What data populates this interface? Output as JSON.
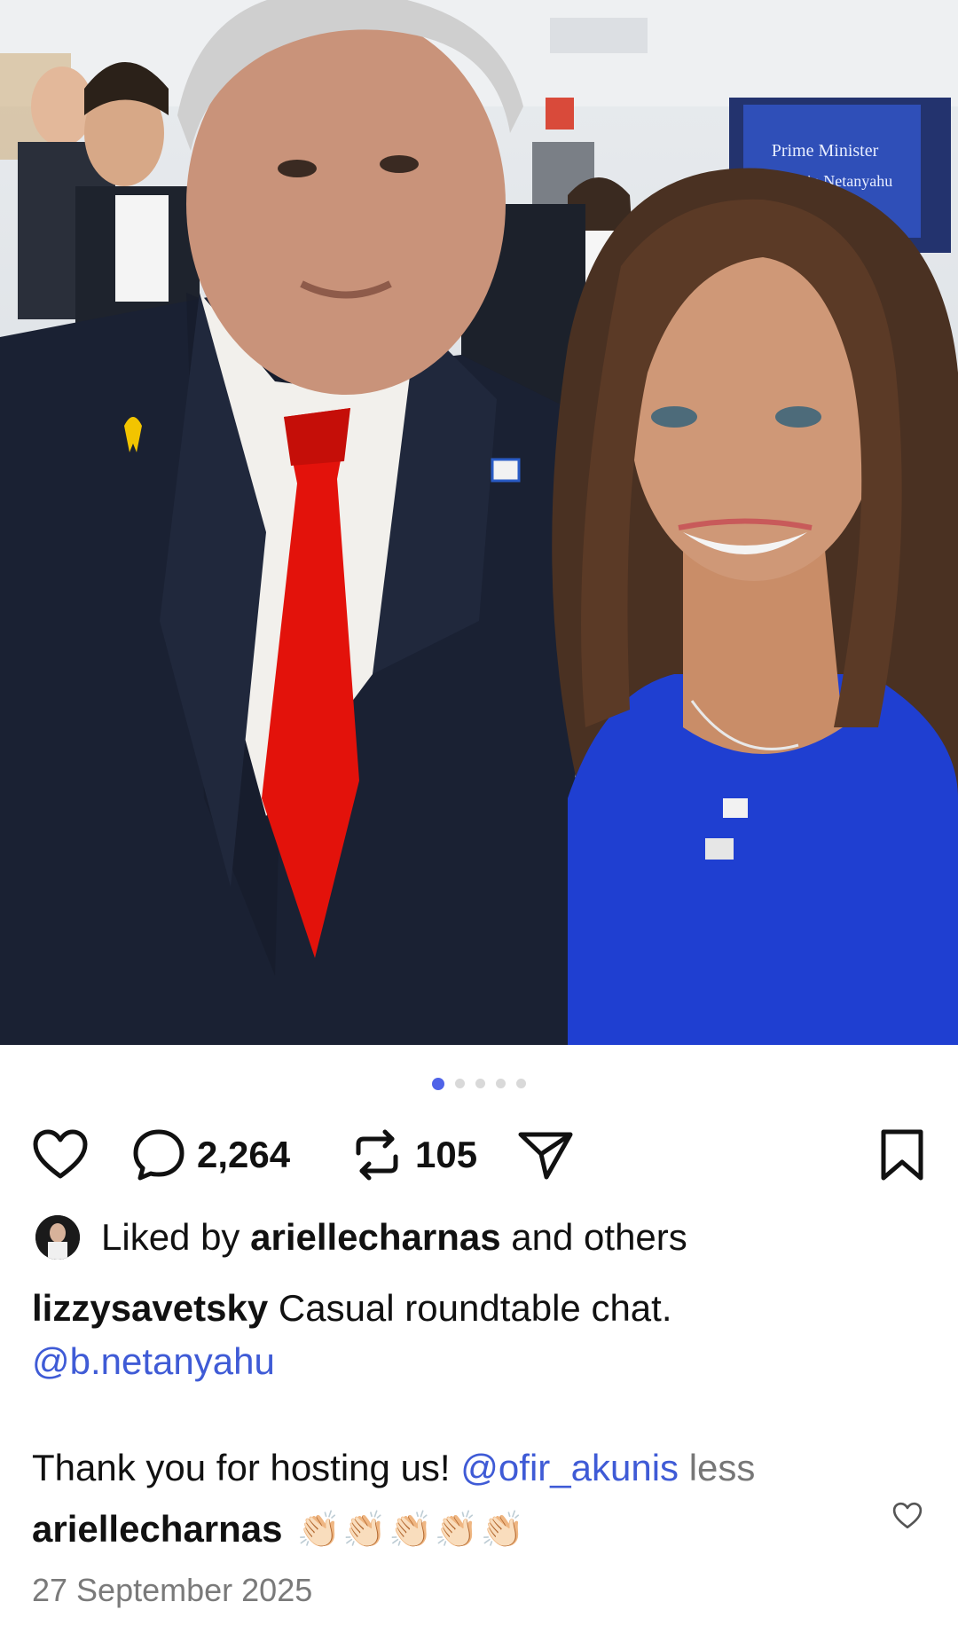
{
  "image": {
    "screen_line1": "Prime Minister",
    "screen_line2": "Benjamin Netanyahu"
  },
  "carousel": {
    "count": 5,
    "active": 0
  },
  "actions": {
    "comments_count": "2,264",
    "reposts_count": "105"
  },
  "liked": {
    "prefix": "Liked by",
    "user": "ariellecharnas",
    "suffix": "and others"
  },
  "caption": {
    "author": "lizzysavetsky",
    "text": "Casual roundtable chat.",
    "mention1": "@b.netanyahu",
    "text2": "Thank you for hosting us!",
    "mention2": "@ofir_akunis",
    "less": "less"
  },
  "comment": {
    "author": "ariellecharnas",
    "emojis": "👏🏻👏🏻👏🏻👏🏻👏🏻"
  },
  "date": "27 September 2025",
  "colors": {
    "link": "#3f5bd6",
    "active_dot": "#4f63e8",
    "dress": "#1f3fd1",
    "tie": "#e3120b"
  },
  "icons": [
    "heart-icon",
    "comment-icon",
    "repost-icon",
    "share-icon",
    "bookmark-icon",
    "heart-small-icon"
  ]
}
